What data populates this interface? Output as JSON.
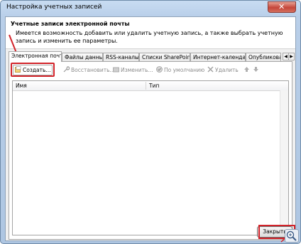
{
  "window": {
    "title": "Настройка учетных записей"
  },
  "header": {
    "title": "Учетные записи электронной почты",
    "description": "Имеется возможность добавить или удалить учетную запись, а также выбрать учетную запись и изменить ее параметры."
  },
  "tabs": [
    {
      "label": "Электронная почта",
      "active": true
    },
    {
      "label": "Файлы данных",
      "active": false
    },
    {
      "label": "RSS-каналы",
      "active": false
    },
    {
      "label": "Списки SharePoint",
      "active": false
    },
    {
      "label": "Интернет-календари",
      "active": false
    },
    {
      "label": "Опубликова",
      "active": false
    }
  ],
  "toolbar": {
    "new_label": "Создать...",
    "repair_label": "Восстановить...",
    "change_label": "Изменить...",
    "default_label": "По умолчанию",
    "remove_label": "Удалить"
  },
  "list": {
    "columns": [
      "Имя",
      "Тип"
    ],
    "rows": []
  },
  "footer": {
    "close_label": "Закрыть"
  },
  "colors": {
    "highlight": "#d2232a",
    "titlebar": "#b9cfe9"
  }
}
